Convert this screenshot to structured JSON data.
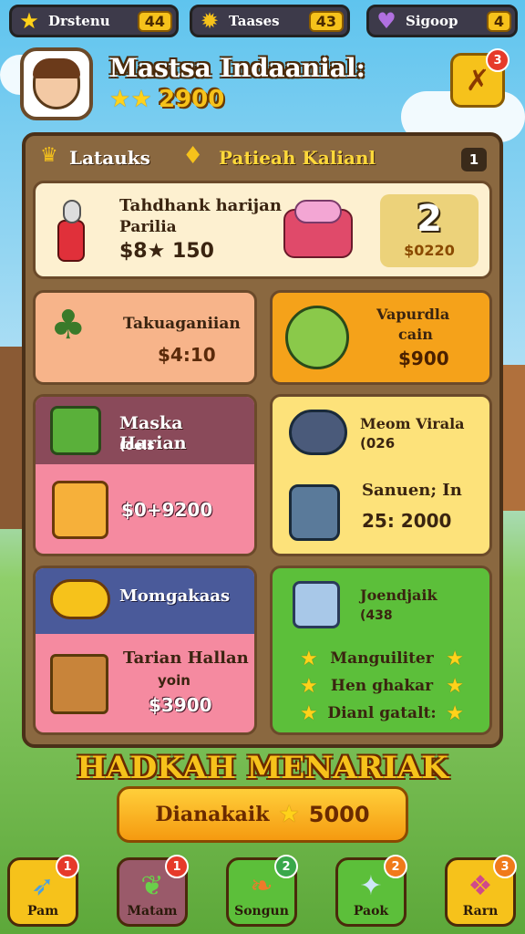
{
  "top_bar": [
    {
      "label": "Drstenu",
      "count": "44",
      "icon": "star-icon"
    },
    {
      "label": "Taases",
      "count": "43",
      "icon": "gear-coin-icon"
    },
    {
      "label": "Sigoop",
      "count": "4",
      "icon": "heart-icon"
    }
  ],
  "profile": {
    "name": "Mastsa Indaanial:",
    "score": "2900",
    "stars": 2,
    "action_badge": "3"
  },
  "panel": {
    "tab1": "Latauks",
    "tab2": "Patieah Kalianl",
    "page": "1"
  },
  "featured": {
    "title": "Tahdhank harijan",
    "subtitle": "Parilia",
    "price": "$8★ 150",
    "badge_number": "2",
    "badge_price": "$0220"
  },
  "cards": [
    {
      "title": "Takuaganiian",
      "price": "$4:10"
    },
    {
      "title": "Vapurdla",
      "sub": "cain",
      "price": "$900"
    },
    {
      "title": "Maska Harian",
      "sub": "(oels",
      "price": "$0+9200"
    },
    {
      "title": "Meom Virala",
      "sub": "(026",
      "title2": "Sanuen; In",
      "price": "25: 2000"
    },
    {
      "title": "Momgakaas",
      "title2": "Tarian Hallan",
      "sub": "yoin",
      "price": "$3900"
    },
    {
      "title": "Joendjaik",
      "sub": "(438",
      "list": [
        "Manguiliter",
        "Hen ghakar",
        "Dianl gatalt:"
      ]
    }
  ],
  "banner": {
    "heading": "HADKAH MENARIAK",
    "button_label": "Dianakaik",
    "button_value": "5000"
  },
  "nav": [
    {
      "label": "Pam",
      "badge": "1"
    },
    {
      "label": "Matam",
      "badge": "1"
    },
    {
      "label": "Songun",
      "badge": "2"
    },
    {
      "label": "Paok",
      "badge": "2"
    },
    {
      "label": "Rarn",
      "badge": "3"
    }
  ],
  "colors": {
    "gold": "#f6c21b",
    "panel": "#8a6840",
    "orange": "#f5a21a",
    "green": "#5cbf3a",
    "pink": "#f58aa0",
    "yellow": "#fde27a"
  }
}
